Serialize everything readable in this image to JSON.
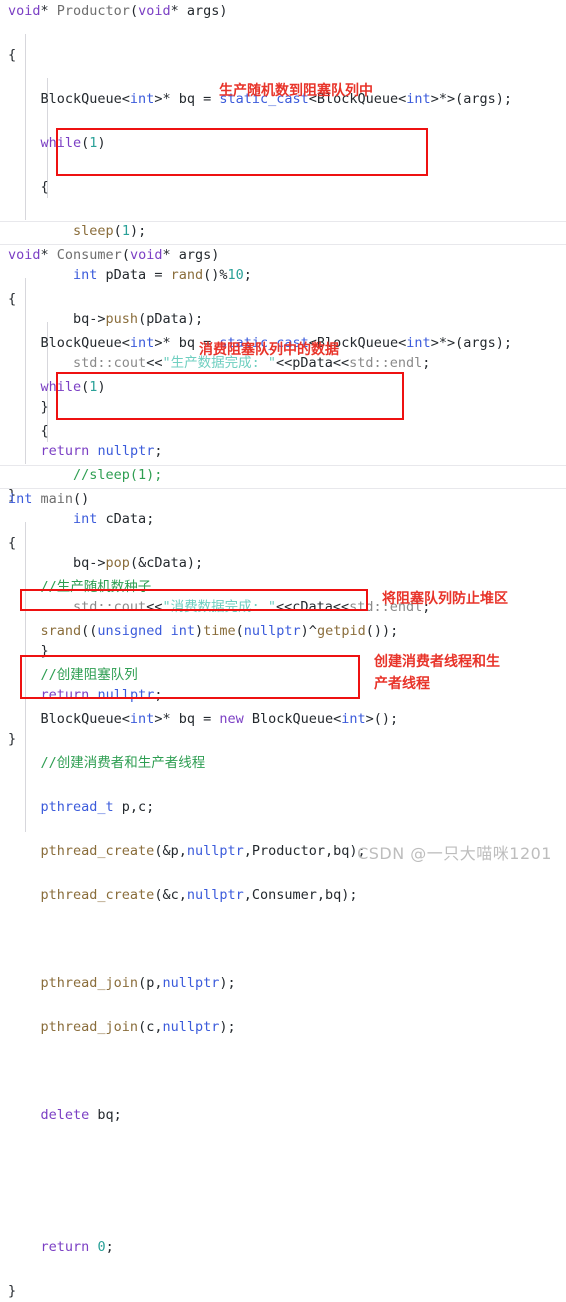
{
  "editor": {
    "language": "C++",
    "background": "#ffffff",
    "colors": {
      "keyword": "#7b3fc4",
      "type": "#3b5bdb",
      "comment": "#2e9e52",
      "string": "#6fcfc0",
      "number": "#2aa198",
      "namespace": "#8a8a8a",
      "call": "#8a6d3b",
      "plain": "#24292e",
      "annotation_red": "#e8342a",
      "box_red": "#ee1111",
      "watermark_gray": "#bdbdbd"
    }
  },
  "code": {
    "producer_block": [
      "void* Productor(void* args)",
      "{",
      "    BlockQueue<int>* bq = static_cast<BlockQueue<int>*>(args);",
      "    while(1)",
      "    {",
      "        sleep(1);",
      "        int pData = rand()%10;",
      "        bq->push(pData);",
      "        std::cout<<\"生产数据完成: \"<<pData<<std::endl;",
      "    }",
      "    return nullptr;",
      "}"
    ],
    "consumer_block": [
      "void* Consumer(void* args)",
      "{",
      "    BlockQueue<int>* bq = static_cast<BlockQueue<int>*>(args);",
      "    while(1)",
      "    {",
      "        //sleep(1);",
      "        int cData;",
      "        bq->pop(&cData);",
      "        std::cout<<\"消费数据完成: \"<<cData<<std::endl;",
      "    }",
      "    return nullptr;",
      "}"
    ],
    "main_block": [
      "int main()",
      "{",
      "    //生产随机数种子",
      "    srand((unsigned int)time(nullptr)^getpid());",
      "    //创建阻塞队列",
      "    BlockQueue<int>* bq = new BlockQueue<int>();",
      "    //创建消费者和生产者线程",
      "    pthread_t p,c;",
      "    pthread_create(&p,nullptr,Productor,bq);",
      "    pthread_create(&c,nullptr,Consumer,bq);",
      "",
      "    pthread_join(p,nullptr);",
      "    pthread_join(c,nullptr);",
      "",
      "    delete bq;",
      "",
      "",
      "    return 0;",
      "}"
    ]
  },
  "annotations": [
    {
      "id": "annot-produce-random",
      "text": "生产随机数到阻塞队列中"
    },
    {
      "id": "annot-consume-queue",
      "text": "消费阻塞队列中的数据"
    },
    {
      "id": "annot-heap-queue",
      "text": "将阻塞队列防止堆区"
    },
    {
      "id": "annot-create-threads-l1",
      "text": "创建消费者线程和生"
    },
    {
      "id": "annot-create-threads-l2",
      "text": "产者线程"
    }
  ],
  "watermark": {
    "text": "CSDN @一只大喵咪1201"
  }
}
